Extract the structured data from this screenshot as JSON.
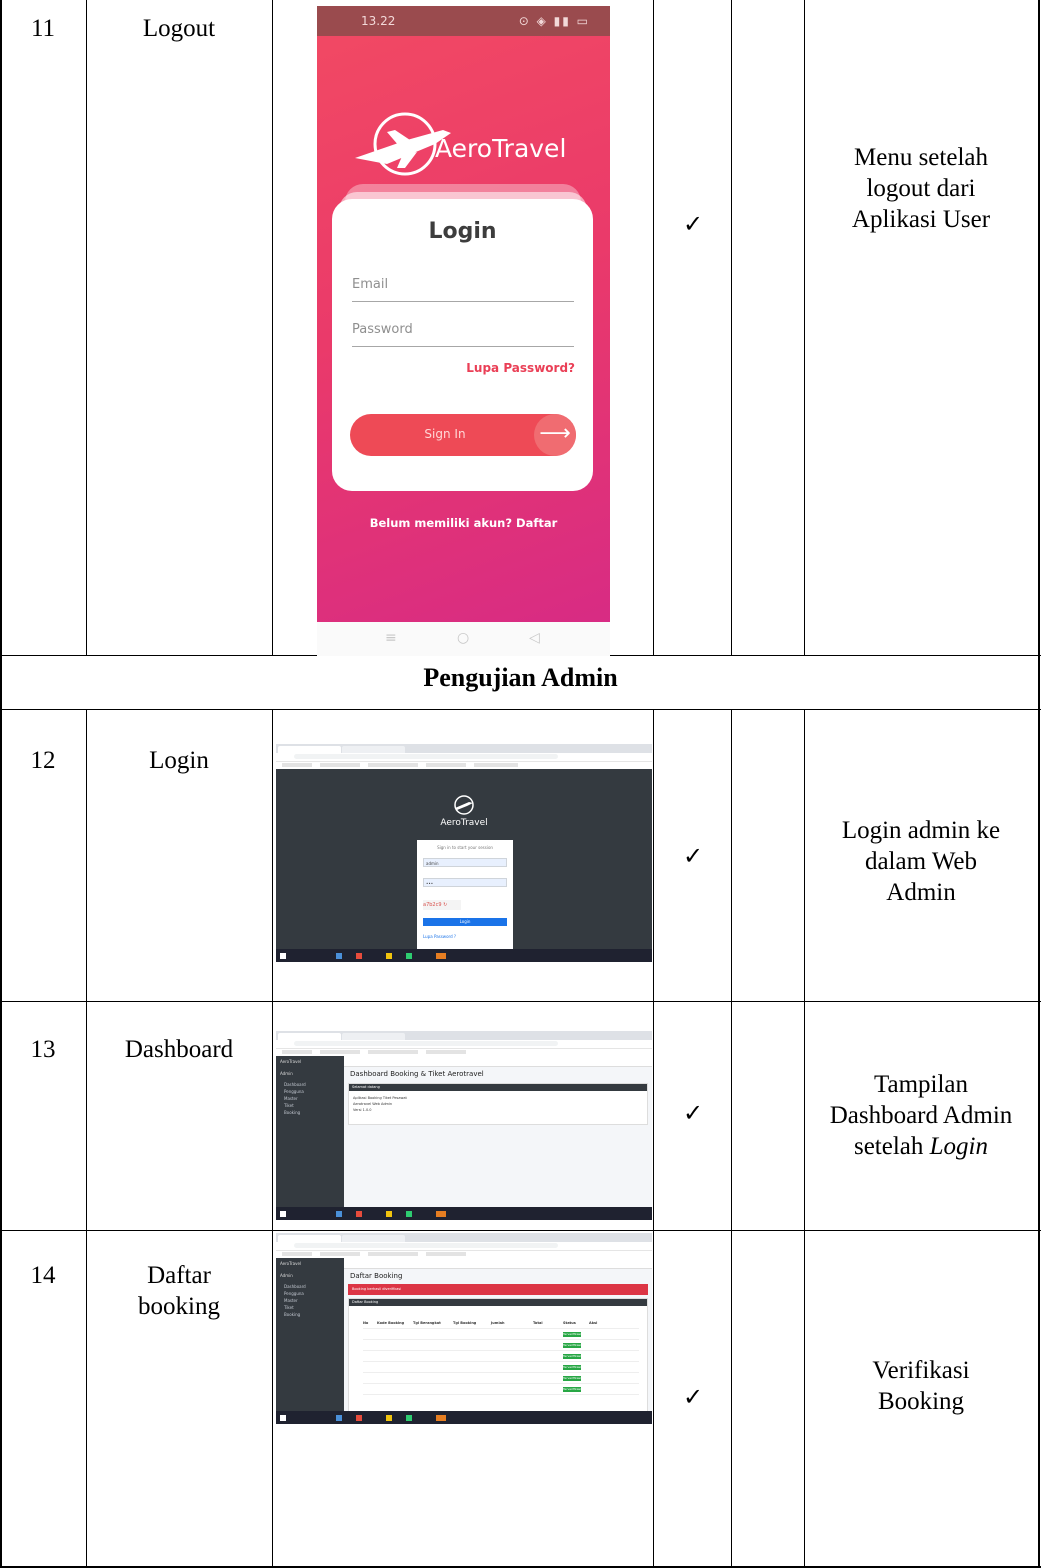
{
  "section_title": "Pengujian Admin",
  "rows": [
    {
      "no": "11",
      "name": "Logout",
      "check": "✓",
      "desc_lines": [
        "Menu setelah",
        "logout dari",
        "Aplikasi User"
      ]
    },
    {
      "no": "12",
      "name": "Login",
      "check": "✓",
      "desc_lines": [
        "Login admin ke",
        "dalam Web",
        "Admin"
      ]
    },
    {
      "no": "13",
      "name": "Dashboard",
      "check": "✓",
      "desc_lines": [
        "Tampilan",
        "Dashboard Admin",
        "setelah "
      ],
      "desc_italic": "Login"
    },
    {
      "no": "14",
      "name_lines": [
        "Daftar",
        "booking"
      ],
      "check": "✓",
      "desc_lines": [
        "Verifikasi",
        "Booking"
      ]
    }
  ],
  "phone": {
    "time": "13.22",
    "status_icons": "⊙ ◈ ▮▮ ▭",
    "app_name": "AeroTravel",
    "login_title": "Login",
    "email_placeholder": "Email",
    "password_placeholder": "Password",
    "forgot": "Lupa Password?",
    "signin": "Sign In",
    "arrow": "⟶",
    "register": "Belum memiliki akun? Daftar",
    "nav": [
      "≡",
      "○",
      "◁"
    ],
    "colors": {
      "gradient_start": "#f24a63",
      "gradient_end": "#d62a86",
      "accent": "#ee4a56"
    }
  },
  "web_login": {
    "logo_text": "AeroTravel",
    "hint": "Sign in to start your session",
    "username": "admin",
    "password": "•••",
    "captcha": "a7b2c9 ↻",
    "button": "Login",
    "link": "Lupa Password ?"
  },
  "dashboard": {
    "brand": "AeroTravel",
    "user": "Admin",
    "nav": [
      "Dashboard",
      "Pengguna",
      "Master",
      "Tiket",
      "Booking"
    ],
    "title": "Dashboard Booking & Tiket Aerotravel",
    "card_head": "Selamat datang",
    "lines": [
      "Aplikasi Booking Tiket Pesawat",
      "Aerotravel Web Admin",
      "Versi 1.0.0"
    ]
  },
  "booking_list": {
    "title": "Daftar Booking",
    "alert": "Booking berhasil diverifikasi",
    "card_head": "Daftar Booking",
    "columns": [
      "No",
      "Kode Booking",
      "Tgl Berangkat",
      "Tgl Booking",
      "Jumlah",
      "Total",
      "Status",
      "Aksi"
    ],
    "status_label": "Terverifikasi"
  }
}
